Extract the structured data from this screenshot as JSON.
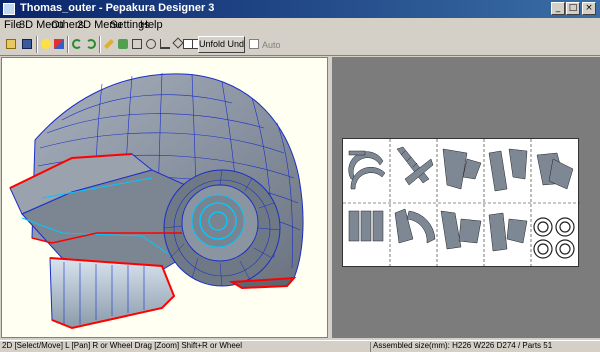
{
  "window": {
    "title": "Thomas_outer - Pepakura Designer 3"
  },
  "menu": {
    "items": [
      "File",
      "3D Menu",
      "Others",
      "2D Menu",
      "Settings",
      "Help"
    ]
  },
  "toolbar": {
    "tools": [
      "open",
      "save",
      "hint",
      "color",
      "undo",
      "redo",
      "edit",
      "paint",
      "join",
      "rotate",
      "anchor",
      "cut",
      "unfold",
      "pan",
      "fit",
      "zoom-in",
      "zoom-out",
      "fold",
      "glue",
      "select",
      "view-single",
      "view-dual"
    ],
    "unfold_label": "Unfold Undo",
    "auto_label": "Auto"
  },
  "colors": {
    "cut_line": "#ff0000",
    "mesh": "#1a2ec8",
    "fold_line": "#00c8ff",
    "helmet": "#8c95a2"
  },
  "status": {
    "left": "2D [Select/Move] L [Pan] R or Wheel Drag [Zoom] Shift+R or Wheel",
    "right": "Assembled size(mm): H226 W226 D274 / Parts 51"
  }
}
